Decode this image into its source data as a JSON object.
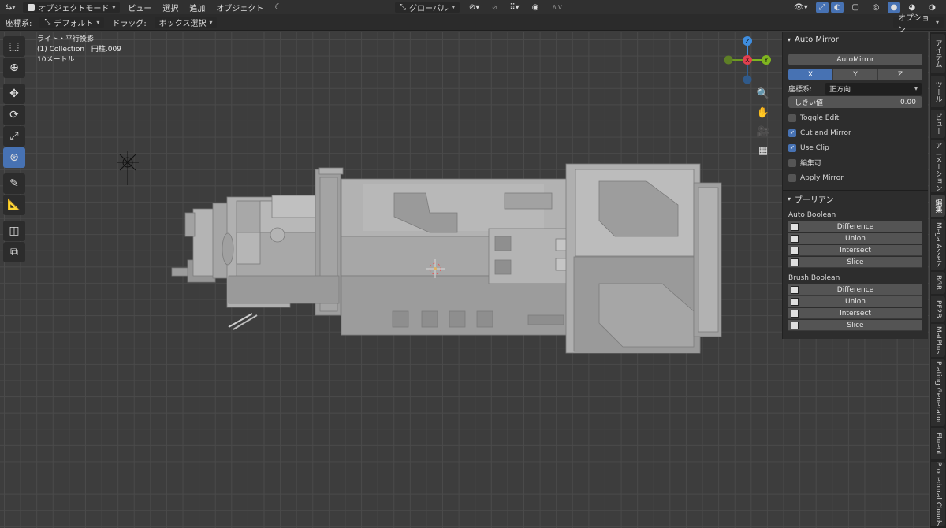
{
  "header": {
    "mode_label": "オブジェクトモード",
    "menus": [
      "ビュー",
      "選択",
      "追加",
      "オブジェクト"
    ],
    "transform_orientation": "グローバル",
    "options_label": "オプション"
  },
  "subheader": {
    "orientation_label": "座標系:",
    "orientation_value": "デフォルト",
    "drag_label": "ドラッグ:",
    "drag_value": "ボックス選択"
  },
  "viewport_info": {
    "line1": "ライト・平行投影",
    "line2": "(1) Collection | 円柱.009",
    "line3": "10メートル"
  },
  "gizmo": {
    "x": "X",
    "y": "Y",
    "z": "Z"
  },
  "panel": {
    "auto_mirror": {
      "title": "Auto Mirror",
      "button": "AutoMirror",
      "axes": [
        "X",
        "Y",
        "Z"
      ],
      "orientation_label": "座標系:",
      "orientation_value": "正方向",
      "threshold_label": "しきい値",
      "threshold_value": "0.00",
      "toggle_edit": "Toggle Edit",
      "cut_and_mirror": "Cut and Mirror",
      "use_clip": "Use Clip",
      "editable": "編集可",
      "apply_mirror": "Apply Mirror"
    },
    "boolean": {
      "title": "ブーリアン",
      "auto_label": "Auto Boolean",
      "brush_label": "Brush Boolean",
      "ops": [
        "Difference",
        "Union",
        "Intersect",
        "Slice"
      ]
    }
  },
  "tabs": [
    "アイテム",
    "ツール",
    "ビュー",
    "アニメーション",
    "編集",
    "Mega Assets",
    "BGR",
    "PF2B",
    "MatPlus",
    "Plating Generator",
    "Fluent",
    "Procedural Clouds"
  ],
  "colors": {
    "accent": "#4772b3",
    "x_axis": "#e2404f",
    "y_axis": "#7fb51f",
    "z_axis": "#3f8ee0"
  }
}
